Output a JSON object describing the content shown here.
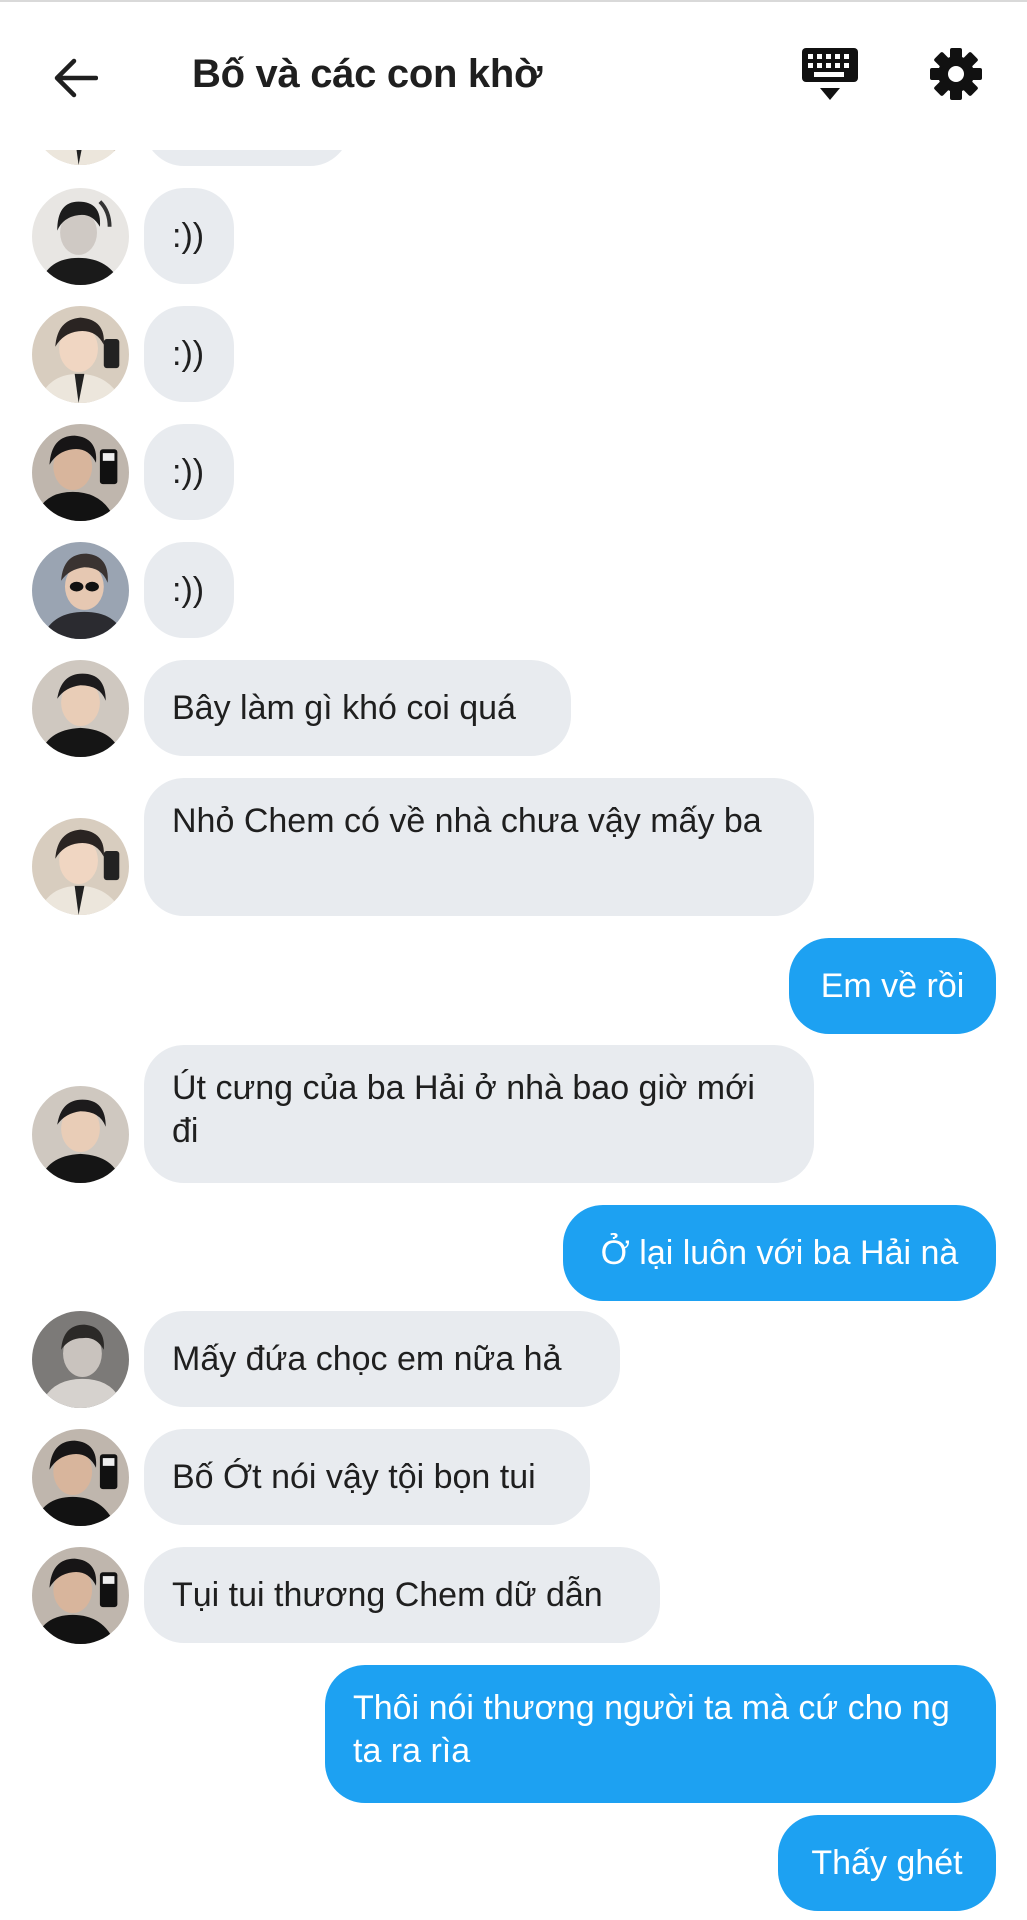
{
  "header": {
    "title": "Bố và các con khờ",
    "back_icon": "arrow-left-icon",
    "keyboard_icon": "keyboard-icon",
    "settings_icon": "gear-icon"
  },
  "colors": {
    "incoming_bubble": "#e8ebef",
    "outgoing_bubble": "#1da1f2",
    "text": "#1f1f1f"
  },
  "messages": [
    {
      "sender": "member",
      "text": ":))"
    },
    {
      "sender": "member",
      "text": ":))"
    },
    {
      "sender": "member",
      "text": ":))"
    },
    {
      "sender": "member",
      "text": ":))"
    },
    {
      "sender": "member",
      "text": "Bây làm gì khó coi quá"
    },
    {
      "sender": "member",
      "text": "Nhỏ Chem có về nhà chưa vậy mấy ba"
    },
    {
      "sender": "me",
      "text": "Em về rồi"
    },
    {
      "sender": "member",
      "text": "Út cưng của ba Hải ở nhà bao giờ mới đi"
    },
    {
      "sender": "me",
      "text": "Ở lại luôn với ba Hải nà"
    },
    {
      "sender": "member",
      "text": "Mấy đứa chọc em nữa hả"
    },
    {
      "sender": "member",
      "text": "Bố Ớt nói vậy tội bọn tui"
    },
    {
      "sender": "member",
      "text": "Tụi tui thương Chem dữ dẫn"
    },
    {
      "sender": "me",
      "text": "Thôi nói thương người ta mà cứ cho ng ta ra rìa"
    },
    {
      "sender": "me",
      "text": "Thấy ghét"
    }
  ]
}
